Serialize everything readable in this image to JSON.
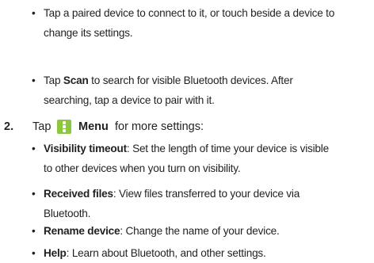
{
  "bullets_top": [
    {
      "lines": [
        {
          "text": "Tap a paired device to connect to it, or touch beside a device to"
        },
        {
          "text": "change its settings."
        }
      ]
    },
    {
      "lines": [
        {
          "pre": "Tap ",
          "bold": "Scan",
          "post": " to search for visible Bluetooth devices. After"
        },
        {
          "text": "searching, tap a device to pair with it."
        }
      ]
    }
  ],
  "step": {
    "number": "2.",
    "tap": "Tap",
    "menu_icon": "menu-icon",
    "menu_label": "Menu",
    "rest": "for more settings:"
  },
  "bullets_bottom": [
    {
      "bold": "Visibility timeout",
      "line1_rest": ": Set the length of time your device is visible",
      "line2": "to other devices when you turn on visibility."
    },
    {
      "bold": "Received files",
      "line1_rest": ": View files transferred to your device via",
      "line2": "Bluetooth."
    },
    {
      "bold": "Rename device",
      "line1_rest": ": Change the name of your device."
    },
    {
      "bold": "Help",
      "line1_rest": ": Learn about Bluetooth, and other settings."
    }
  ],
  "bullet_char": "•"
}
